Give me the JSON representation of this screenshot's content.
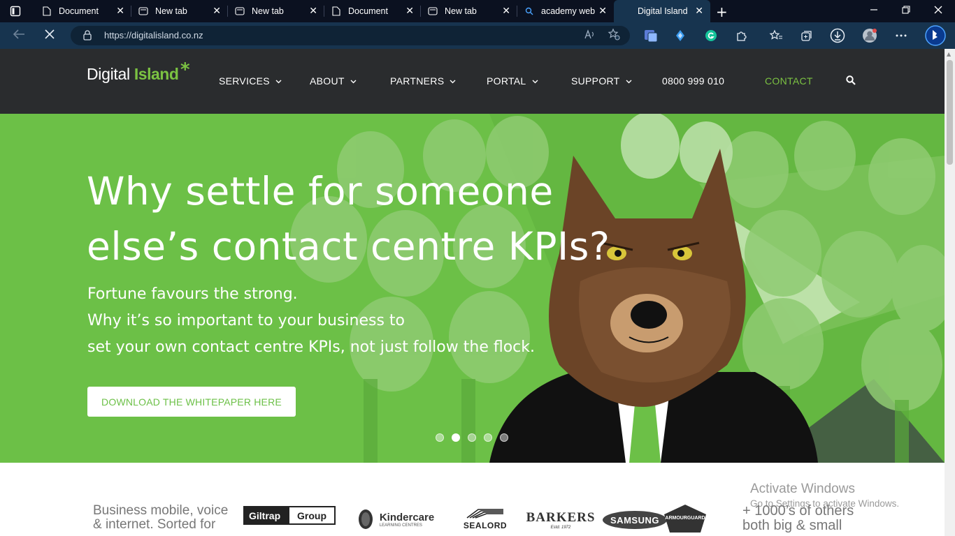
{
  "browser": {
    "tabs": [
      {
        "title": "Document",
        "icon": "document-icon"
      },
      {
        "title": "New tab",
        "icon": "newtab-icon"
      },
      {
        "title": "New tab",
        "icon": "newtab-icon"
      },
      {
        "title": "Document",
        "icon": "document-icon"
      },
      {
        "title": "New tab",
        "icon": "newtab-icon"
      },
      {
        "title": "academy web",
        "icon": "search-icon"
      },
      {
        "title": "Digital Island",
        "icon": "loading-icon",
        "active": true
      }
    ],
    "url": "https://digitalisland.co.nz",
    "close_glyph": "✕",
    "new_tab_glyph": "+",
    "toolbar_icons": [
      "collections-icon",
      "extension-drop-icon",
      "grammarly-icon",
      "extensions-icon",
      "favorites-icon",
      "collections-stack-icon",
      "downloads-icon",
      "profile-icon",
      "more-icon",
      "bing-icon"
    ]
  },
  "site": {
    "logo": {
      "part1": "Digital ",
      "part2": "Island",
      "star": "*"
    },
    "nav": {
      "services": "SERVICES",
      "about": "ABOUT",
      "partners": "PARTNERS",
      "portal": "PORTAL",
      "support": "SUPPORT",
      "phone": "0800 999 010",
      "contact": "CONTACT"
    },
    "chevron": "⌄",
    "accent_color": "#7bc242",
    "header_bg": "#2a2c2e"
  },
  "hero": {
    "title_line1": "Why settle for someone",
    "title_line2": "else’s contact centre KPIs?",
    "sub_line1": "Fortune favours the strong.",
    "sub_line2": "Why it’s so important to your business to",
    "sub_line3": "set your own contact centre KPIs, not just follow the flock.",
    "cta": "DOWNLOAD THE WHITEPAPER HERE",
    "slides_total": 5,
    "slide_active": 2
  },
  "clients": {
    "tagline_line1": "Business mobile, voice",
    "tagline_line2": "& internet. Sorted for",
    "logos": {
      "giltrap_a": "Giltrap",
      "giltrap_b": "Group",
      "kindercare": "Kindercare",
      "kindercare_sub": "LEARNING CENTRES",
      "sealord": "SEALORD",
      "barkers": "BARKERS",
      "barkers_sub": "Estd. 1972",
      "samsung": "SAMSUNG",
      "armourguard": "ARMOURGUARD"
    },
    "others_line1": "+ 1000’s of others",
    "others_line2": "both big & small"
  },
  "os": {
    "watermark_line1": "Activate Windows",
    "watermark_line2": "Go to Settings to activate Windows."
  }
}
